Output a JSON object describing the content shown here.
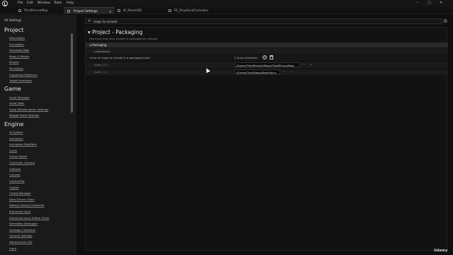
{
  "menubar": {
    "items": [
      "File",
      "Edit",
      "Window",
      "Tools",
      "Help"
    ],
    "controls": [
      "–",
      "□",
      "✕"
    ]
  },
  "tabs": [
    {
      "label": "ThirdPersonMap"
    },
    {
      "label": "Project Settings",
      "close": "✕"
    },
    {
      "label": "W_MainHUD"
    },
    {
      "label": "PC_PropHuntController"
    }
  ],
  "sidebar": {
    "all_settings": "All Settings",
    "sections": [
      {
        "title": "Project",
        "items": [
          "Description",
          "Encryption",
          "GameplayTags",
          "Maps & Modes",
          "Movies",
          "Packaging",
          "Supported Platforms",
          "Target Hardware"
        ]
      },
      {
        "title": "Game",
        "items": [
          "Asset Manager",
          "Asset Tools",
          "State WithRenderer Settings",
          "Widget State Settings"
        ]
      },
      {
        "title": "Engine",
        "items": [
          "AI System",
          "Animation",
          "Animation Modifiers",
          "Audio",
          "Chaos Solver",
          "Cinematic Camera",
          "Collision",
          "Console",
          "Control Rig",
          "Cooker",
          "Crowd Manager",
          "Data Driven CVars",
          "Debug Camera Controller",
          "Enhanced Input",
          "Enhanced Input (Editor Only)",
          "Gameplay Debugger",
          "Garbage Collection",
          "General Settings",
          "Hierarchical LOD",
          "Input"
        ]
      }
    ]
  },
  "search": {
    "value": "maps to include",
    "close": "✕"
  },
  "main": {
    "title": "Project - Packaging",
    "description": "Fine-tune how your project is packaged for release.",
    "category": "Packaging",
    "advanced": "Advanced",
    "property": {
      "label": "List of maps to include in a packaged build",
      "count": "2 Array elements",
      "add": "+"
    },
    "elements": [
      {
        "index": "Index [ 0 ]",
        "value": "/Game/ThirdPerson/Maps/ThirdPersonMap"
      },
      {
        "index": "Index [ 1 ]",
        "value": "/Game/Core/Maps/MainMenu"
      }
    ],
    "browse": "...",
    "chevron": "⌄"
  },
  "watermark": "Udemy"
}
